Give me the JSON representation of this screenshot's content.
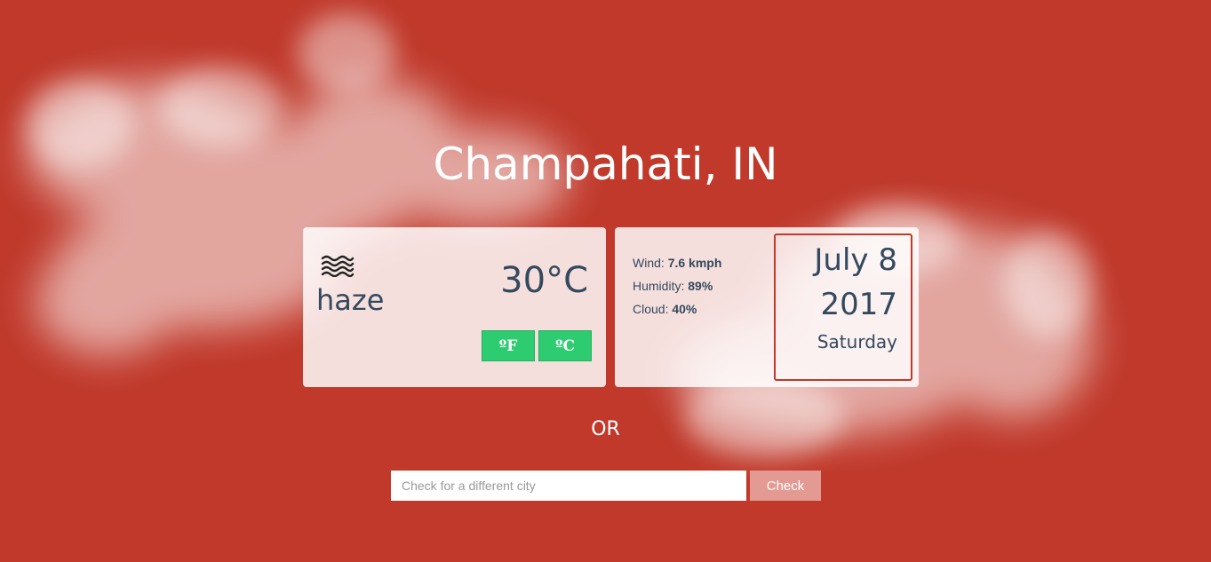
{
  "location": {
    "title": "Champahati, IN"
  },
  "current": {
    "icon": "haze-icon",
    "condition": "haze",
    "temperature": "30°C",
    "unit_f_label": "ºF",
    "unit_c_label": "ºC"
  },
  "details": {
    "wind_label": "Wind:",
    "wind_value": "7.6 kmph",
    "humidity_label": "Humidity:",
    "humidity_value": "89%",
    "cloud_label": "Cloud:",
    "cloud_value": "40%"
  },
  "date": {
    "month_day": "July 8",
    "year": "2017",
    "weekday": "Saturday"
  },
  "separator": {
    "label": "OR"
  },
  "search": {
    "placeholder": "Check for a different city",
    "value": "",
    "button_label": "Check"
  },
  "colors": {
    "background": "#c0392b",
    "text_dark": "#34495e",
    "unit_button": "#2ecc71",
    "check_button": "#e39a92"
  }
}
